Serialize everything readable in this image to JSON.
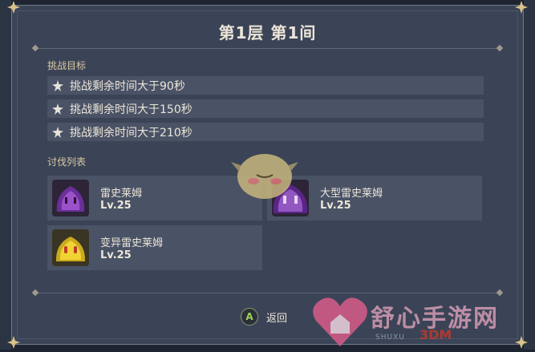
{
  "header": {
    "title": "第1层 第1间"
  },
  "goals": {
    "label": "挑战目标",
    "items": [
      {
        "text": "挑战剩余时间大于90秒"
      },
      {
        "text": "挑战剩余时间大于150秒"
      },
      {
        "text": "挑战剩余时间大于210秒"
      }
    ]
  },
  "enemies": {
    "label": "讨伐列表",
    "items": [
      {
        "name": "雷史莱姆",
        "level": "Lv.25",
        "icon": "electro-slime-icon"
      },
      {
        "name": "大型雷史莱姆",
        "level": "Lv.25",
        "icon": "large-electro-slime-icon"
      },
      {
        "name": "变异雷史莱姆",
        "level": "Lv.25",
        "icon": "mutant-electro-slime-icon"
      }
    ]
  },
  "footer": {
    "button_key": "A",
    "back_label": "返回"
  },
  "watermark": {
    "text": "舒心手游网",
    "site": "3DM",
    "sub": "SHUXU"
  }
}
